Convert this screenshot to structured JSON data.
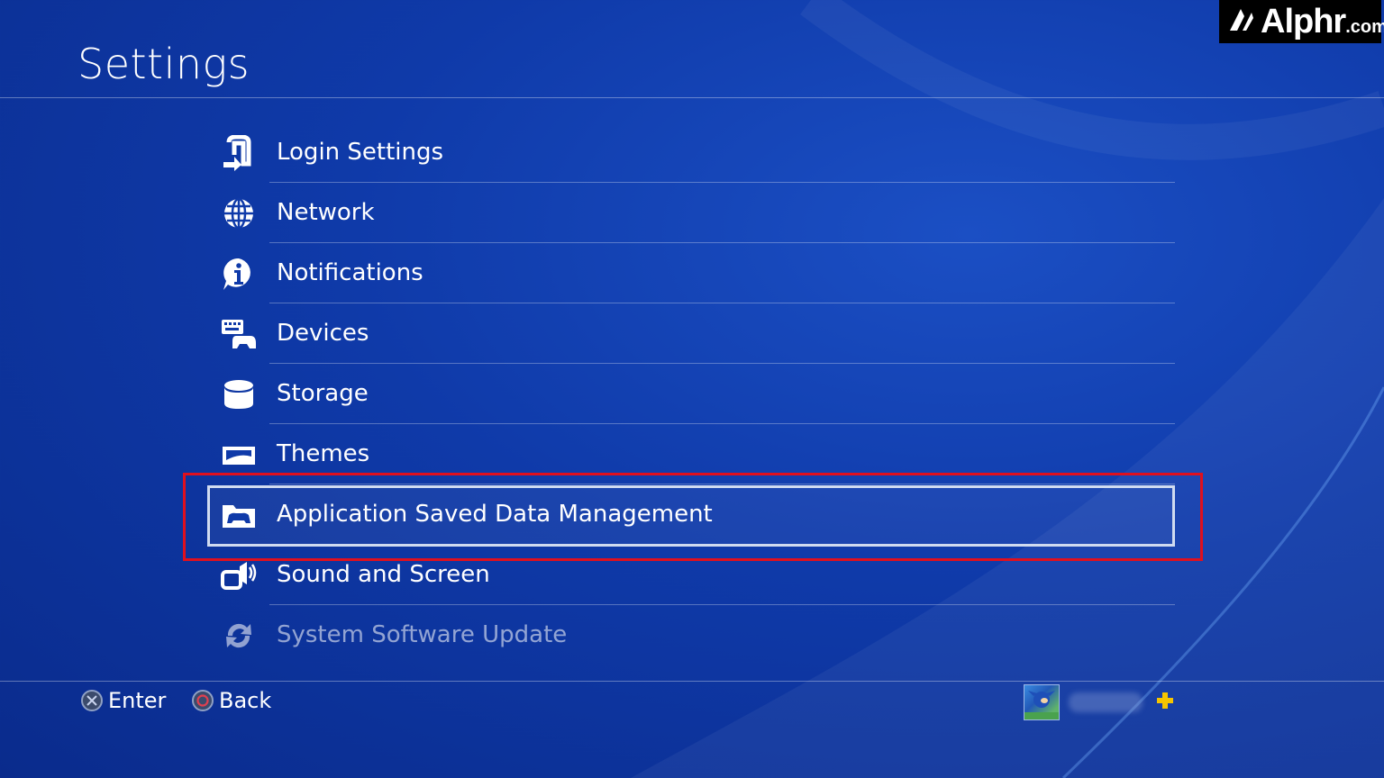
{
  "header": {
    "title": "Settings"
  },
  "menu": {
    "items": [
      {
        "label": "Login Settings",
        "icon": "login-icon"
      },
      {
        "label": "Network",
        "icon": "globe-icon"
      },
      {
        "label": "Notifications",
        "icon": "info-icon"
      },
      {
        "label": "Devices",
        "icon": "devices-icon"
      },
      {
        "label": "Storage",
        "icon": "storage-icon"
      },
      {
        "label": "Themes",
        "icon": "themes-icon"
      },
      {
        "label": "Application Saved Data Management",
        "icon": "folder-controller-icon",
        "selected": true
      },
      {
        "label": "Sound and Screen",
        "icon": "speaker-icon"
      },
      {
        "label": "System Software Update",
        "icon": "refresh-icon"
      }
    ]
  },
  "footer": {
    "enter_label": "Enter",
    "back_label": "Back"
  },
  "branding": {
    "logo_name": "Alphr",
    "logo_suffix": ".com"
  },
  "colors": {
    "background": "#0f3aa9",
    "highlight_box": "#e0101e",
    "selection_border": "#d0dbf0"
  }
}
